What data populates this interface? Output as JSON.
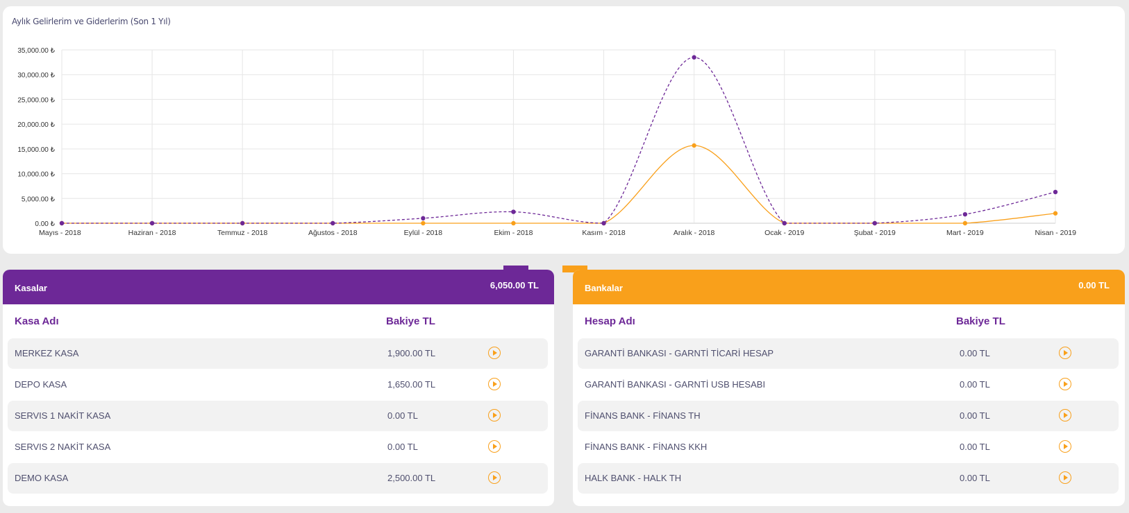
{
  "chart_data": {
    "type": "line",
    "title": "Aylık Gelirlerim ve Giderlerim (Son 1 Yıl)",
    "categories": [
      "Mayıs - 2018",
      "Haziran - 2018",
      "Temmuz - 2018",
      "Ağustos - 2018",
      "Eylül - 2018",
      "Ekim - 2018",
      "Kasım - 2018",
      "Aralık - 2018",
      "Ocak - 2019",
      "Şubat - 2019",
      "Mart - 2019",
      "Nisan - 2019"
    ],
    "series": [
      {
        "name": "",
        "color": "#6d2897",
        "style": "dashed",
        "values": [
          0,
          0,
          0,
          0,
          1000,
          2300,
          0,
          33500,
          0,
          0,
          1800,
          6300
        ]
      },
      {
        "name": "",
        "color": "#f9a01b",
        "style": "solid",
        "values": [
          0,
          0,
          0,
          0,
          0,
          0,
          0,
          15700,
          0,
          0,
          0,
          2000
        ]
      }
    ],
    "yticks": [
      "0.00 ₺",
      "5,000.00 ₺",
      "10,000.00 ₺",
      "15,000.00 ₺",
      "20,000.00 ₺",
      "25,000.00 ₺",
      "30,000.00 ₺",
      "35,000.00 ₺"
    ],
    "ylim": [
      0,
      35000
    ],
    "grid": true,
    "legend": "bottom"
  },
  "kasalar": {
    "title": "Kasalar",
    "total": "6,050.00  TL",
    "col_name": "Kasa Adı",
    "col_balance": "Bakiye TL",
    "rows": [
      {
        "name": "MERKEZ KASA",
        "balance": "1,900.00  TL"
      },
      {
        "name": "DEPO KASA",
        "balance": "1,650.00  TL"
      },
      {
        "name": "SERVIS 1 NAKİT KASA",
        "balance": "0.00  TL"
      },
      {
        "name": "SERVIS 2 NAKİT KASA",
        "balance": "0.00  TL"
      },
      {
        "name": "DEMO KASA",
        "balance": "2,500.00  TL"
      }
    ]
  },
  "bankalar": {
    "title": "Bankalar",
    "total": "0.00  TL",
    "col_name": "Hesap Adı",
    "col_balance": "Bakiye TL",
    "rows": [
      {
        "name": "GARANTİ BANKASI  -  GARNTİ TİCARİ HESAP",
        "balance": "0.00  TL"
      },
      {
        "name": "GARANTİ BANKASI  -  GARNTİ USB HESABI",
        "balance": "0.00  TL"
      },
      {
        "name": "FİNANS BANK  -  FİNANS TH",
        "balance": "0.00  TL"
      },
      {
        "name": "FİNANS BANK  -  FİNANS KKH",
        "balance": "0.00  TL"
      },
      {
        "name": "HALK BANK  -  HALK TH",
        "balance": "0.00  TL"
      }
    ]
  },
  "icons": {
    "row_action": "play-circle-icon"
  },
  "colors": {
    "purple": "#6d2897",
    "orange": "#f9a01b"
  }
}
